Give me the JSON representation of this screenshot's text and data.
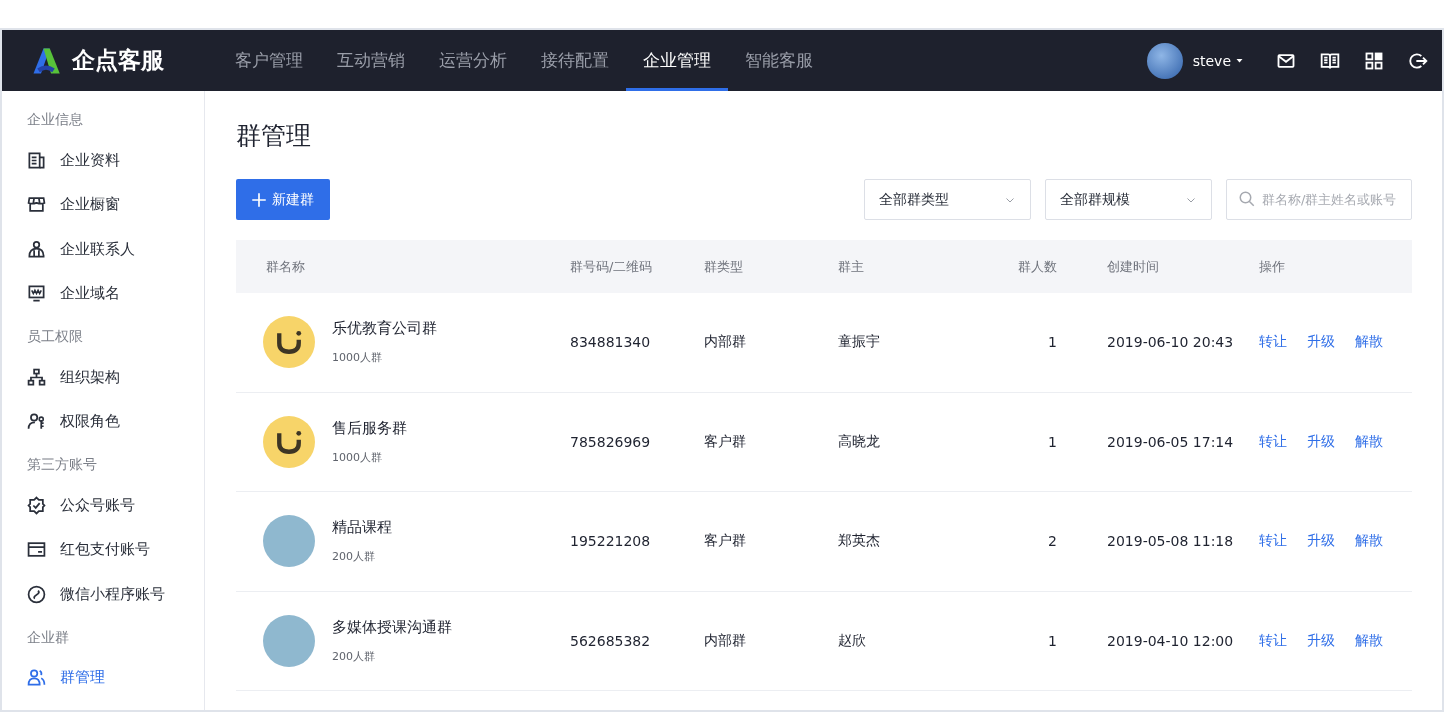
{
  "header": {
    "logo_text": "企点客服",
    "nav": [
      {
        "label": "客户管理",
        "selected": false
      },
      {
        "label": "互动营销",
        "selected": false
      },
      {
        "label": "运营分析",
        "selected": false
      },
      {
        "label": "接待配置",
        "selected": false
      },
      {
        "label": "企业管理",
        "selected": true
      },
      {
        "label": "智能客服",
        "selected": false
      }
    ],
    "user": "steve"
  },
  "sidebar": {
    "sections": [
      {
        "title": "企业信息",
        "items": [
          {
            "label": "企业资料",
            "selected": false
          },
          {
            "label": "企业橱窗",
            "selected": false
          },
          {
            "label": "企业联系人",
            "selected": false
          },
          {
            "label": "企业域名",
            "selected": false
          }
        ]
      },
      {
        "title": "员工权限",
        "items": [
          {
            "label": "组织架构",
            "selected": false
          },
          {
            "label": "权限角色",
            "selected": false
          }
        ]
      },
      {
        "title": "第三方账号",
        "items": [
          {
            "label": "公众号账号",
            "selected": false
          },
          {
            "label": "红包支付账号",
            "selected": false
          },
          {
            "label": "微信小程序账号",
            "selected": false
          }
        ]
      },
      {
        "title": "企业群",
        "items": [
          {
            "label": "群管理",
            "selected": true
          }
        ]
      }
    ]
  },
  "page": {
    "title": "群管理",
    "new_button": "新建群",
    "filters": [
      "全部群类型",
      "全部群规模"
    ],
    "search": {
      "placeholder": "群名称/群主姓名或账号"
    }
  },
  "table": {
    "columns": [
      "群名称",
      "群号码/二维码",
      "群类型",
      "群主",
      "群人数",
      "创建时间",
      "操作"
    ],
    "rows": [
      {
        "kind": "logo",
        "name": "乐优教育公司群",
        "size": "1000人群",
        "number": "834881340",
        "type": "内部群",
        "owner": "童振宇",
        "members": "1",
        "created": "2019-06-10 20:43",
        "actions": [
          "转让",
          "升级",
          "解散"
        ]
      },
      {
        "kind": "logo",
        "name": "售后服务群",
        "size": "1000人群",
        "number": "785826969",
        "type": "客户群",
        "owner": "高晓龙",
        "members": "1",
        "created": "2019-06-05 17:14",
        "actions": [
          "转让",
          "升级",
          "解散"
        ]
      },
      {
        "kind": "photo",
        "name": "精品课程",
        "size": "200人群",
        "number": "195221208",
        "type": "客户群",
        "owner": "郑英杰",
        "members": "2",
        "created": "2019-05-08 11:18",
        "actions": [
          "转让",
          "升级",
          "解散"
        ]
      },
      {
        "kind": "photo",
        "name": "多媒体授课沟通群",
        "size": "200人群",
        "number": "562685382",
        "type": "内部群",
        "owner": "赵欣",
        "members": "1",
        "created": "2019-04-10 12:00",
        "actions": [
          "转让",
          "升级",
          "解散"
        ]
      }
    ]
  }
}
